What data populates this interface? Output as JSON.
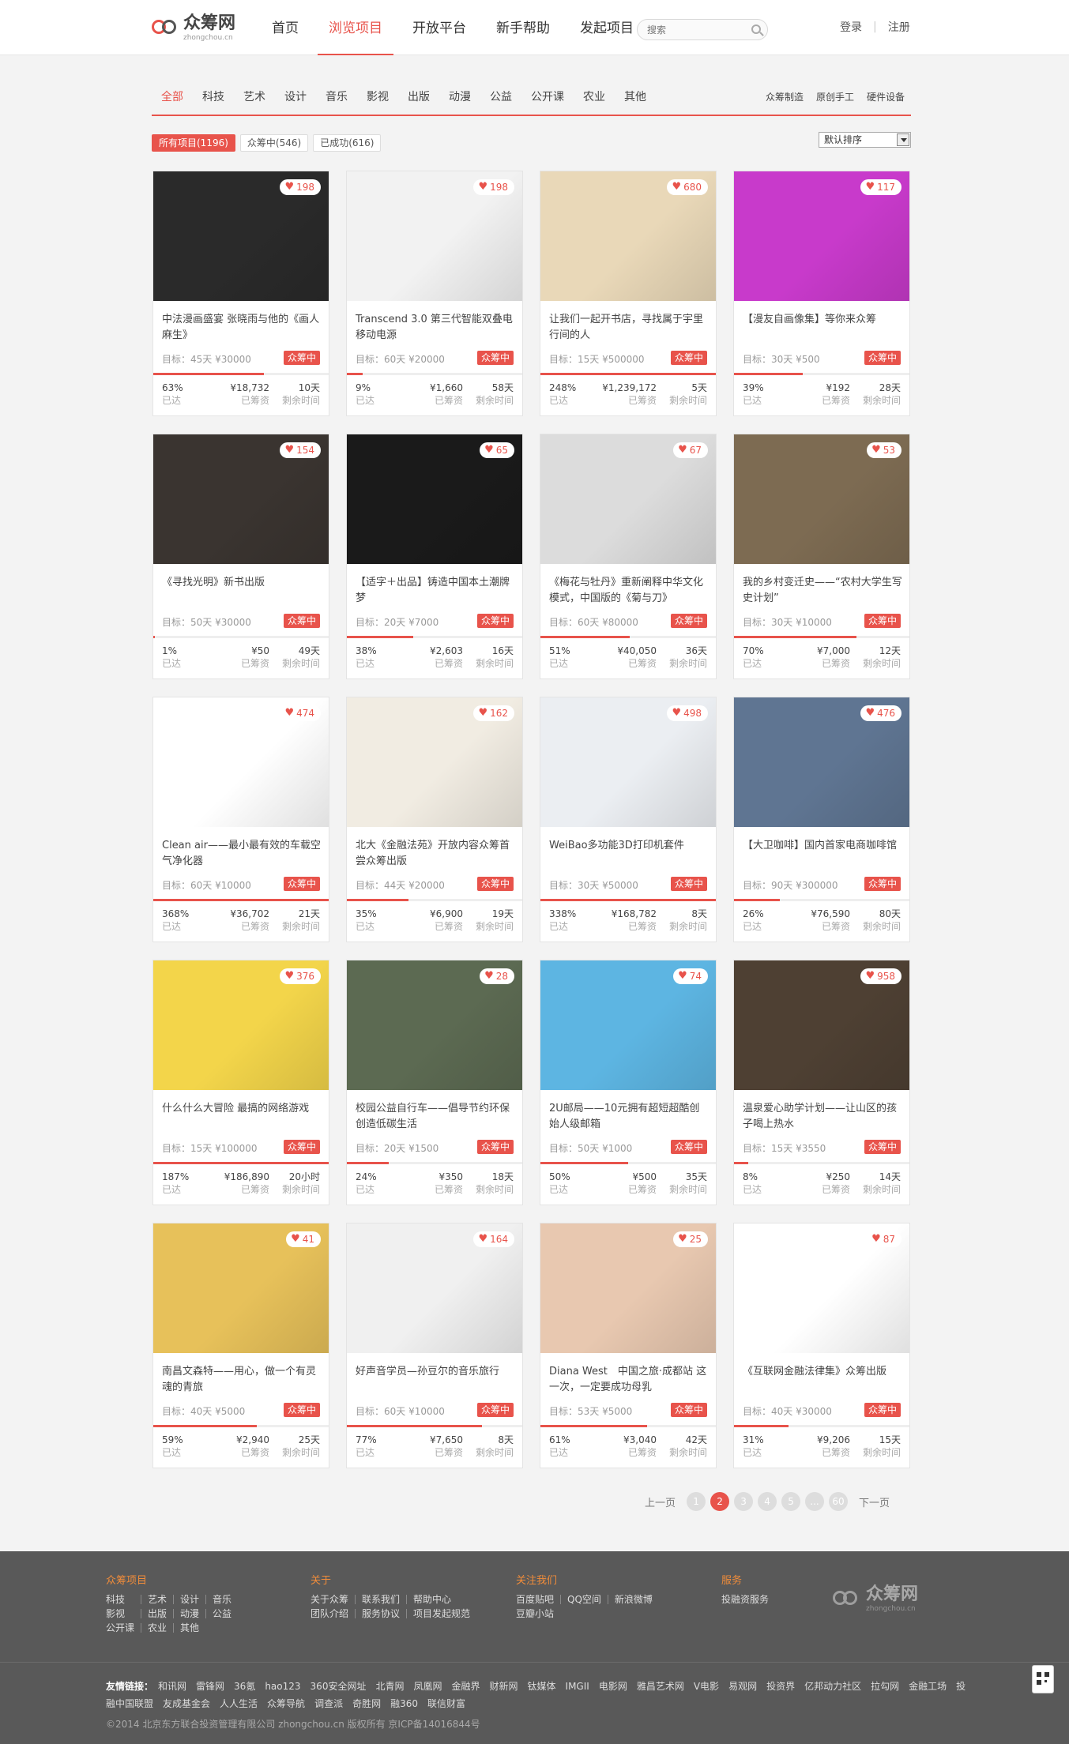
{
  "header": {
    "logo_cn": "众筹网",
    "logo_en": "zhongchou.cn",
    "nav": [
      "首页",
      "浏览项目",
      "开放平台",
      "新手帮助",
      "发起项目"
    ],
    "nav_active": 1,
    "search_placeholder": "搜索",
    "login": "登录",
    "register": "注册"
  },
  "categories": {
    "items": [
      "全部",
      "科技",
      "艺术",
      "设计",
      "音乐",
      "影视",
      "出版",
      "动漫",
      "公益",
      "公开课",
      "农业",
      "其他"
    ],
    "active": 0,
    "right": [
      "众筹制造",
      "原创手工",
      "硬件设备"
    ]
  },
  "filters": {
    "tabs": [
      "所有项目(1196)",
      "众筹中(546)",
      "已成功(616)"
    ],
    "active": 0,
    "sort_value": "默认排序"
  },
  "labels": {
    "goal_prefix": "目标：",
    "status": "众筹中",
    "reached": "已达",
    "raised": "已筹资",
    "remaining": "剩余时间"
  },
  "projects": [
    {
      "title": "中法漫画盛宴 张晓雨与他的《画人麻生》",
      "goal": "45天 ¥30000",
      "likes": "198",
      "pct": "63%",
      "amount": "¥18,732",
      "days": "10天",
      "progress": 0.63,
      "color": "#2a2a2a"
    },
    {
      "title": "Transcend 3.0 第三代智能双叠电移动电源",
      "goal": "60天 ¥20000",
      "likes": "198",
      "pct": "9%",
      "amount": "¥1,660",
      "days": "58天",
      "progress": 0.09,
      "color": "#f2f2f2"
    },
    {
      "title": "让我们一起开书店，寻找属于宇里行间的人",
      "goal": "15天 ¥500000",
      "likes": "680",
      "pct": "248%",
      "amount": "¥1,239,172",
      "days": "5天",
      "progress": 1.0,
      "color": "#e9d8b8"
    },
    {
      "title": "【漫友自画像集】等你来众筹",
      "goal": "30天 ¥500",
      "likes": "117",
      "pct": "39%",
      "amount": "¥192",
      "days": "28天",
      "progress": 0.39,
      "color": "#c83acb"
    },
    {
      "title": "《寻找光明》新书出版",
      "goal": "50天 ¥30000",
      "likes": "154",
      "pct": "1%",
      "amount": "¥50",
      "days": "49天",
      "progress": 0.01,
      "color": "#3a3430"
    },
    {
      "title": "【适字＋出品】铸造中国本土潮牌梦",
      "goal": "20天 ¥7000",
      "likes": "65",
      "pct": "38%",
      "amount": "¥2,603",
      "days": "16天",
      "progress": 0.38,
      "color": "#1a1a1a"
    },
    {
      "title": "《梅花与牡丹》重新阐释中华文化模式，中国版的《菊与刀》",
      "goal": "60天 ¥80000",
      "likes": "67",
      "pct": "51%",
      "amount": "¥40,050",
      "days": "36天",
      "progress": 0.51,
      "color": "#dcdcdc"
    },
    {
      "title": "我的乡村变迁史——“农村大学生写史计划”",
      "goal": "30天 ¥10000",
      "likes": "53",
      "pct": "70%",
      "amount": "¥7,000",
      "days": "12天",
      "progress": 0.7,
      "color": "#7d6b52"
    },
    {
      "title": "Clean air——最小最有效的车载空气净化器",
      "goal": "60天 ¥10000",
      "likes": "474",
      "pct": "368%",
      "amount": "¥36,702",
      "days": "21天",
      "progress": 1.0,
      "color": "#ffffff"
    },
    {
      "title": "北大《金融法苑》开放内容众筹首尝众筹出版",
      "goal": "44天 ¥20000",
      "likes": "162",
      "pct": "35%",
      "amount": "¥6,900",
      "days": "19天",
      "progress": 0.35,
      "color": "#f1ece2"
    },
    {
      "title": "WeiBao多功能3D打印机套件",
      "goal": "30天 ¥50000",
      "likes": "498",
      "pct": "338%",
      "amount": "¥168,782",
      "days": "8天",
      "progress": 1.0,
      "color": "#ebeef2"
    },
    {
      "title": "【大卫咖啡】国内首家电商咖啡馆",
      "goal": "90天 ¥300000",
      "likes": "476",
      "pct": "26%",
      "amount": "¥76,590",
      "days": "80天",
      "progress": 0.26,
      "color": "#5f7592"
    },
    {
      "title": "什么什么大冒险 最搞的网络游戏",
      "goal": "15天 ¥100000",
      "likes": "376",
      "pct": "187%",
      "amount": "¥186,890",
      "days": "20小时",
      "progress": 1.0,
      "color": "#f3d54a"
    },
    {
      "title": "校园公益自行车——倡导节约环保 创造低碳生活",
      "goal": "20天 ¥1500",
      "likes": "28",
      "pct": "24%",
      "amount": "¥350",
      "days": "18天",
      "progress": 0.24,
      "color": "#5c6a52"
    },
    {
      "title": "2U邮局——10元拥有超短超酷创始人级邮箱",
      "goal": "50天 ¥1000",
      "likes": "74",
      "pct": "50%",
      "amount": "¥500",
      "days": "35天",
      "progress": 0.5,
      "color": "#5db5e2"
    },
    {
      "title": "温泉爱心助学计划——让山区的孩子喝上热水",
      "goal": "15天 ¥3550",
      "likes": "958",
      "pct": "8%",
      "amount": "¥250",
      "days": "14天",
      "progress": 0.08,
      "color": "#4e4033"
    },
    {
      "title": "南昌文森特——用心，做一个有灵魂的青旅",
      "goal": "40天 ¥5000",
      "likes": "41",
      "pct": "59%",
      "amount": "¥2,940",
      "days": "25天",
      "progress": 0.59,
      "color": "#e7c15a"
    },
    {
      "title": "好声音学员—孙豆尔的音乐旅行",
      "goal": "60天 ¥10000",
      "likes": "164",
      "pct": "77%",
      "amount": "¥7,650",
      "days": "8天",
      "progress": 0.77,
      "color": "#f0f0f0"
    },
    {
      "title": "Diana West　中国之旅·成都站 这一次，一定要成功母乳",
      "goal": "53天 ¥5000",
      "likes": "25",
      "pct": "61%",
      "amount": "¥3,040",
      "days": "42天",
      "progress": 0.61,
      "color": "#e8c8b0"
    },
    {
      "title": "《互联网金融法律集》众筹出版",
      "goal": "40天 ¥30000",
      "likes": "87",
      "pct": "31%",
      "amount": "¥9,206",
      "days": "15天",
      "progress": 0.31,
      "color": "#ffffff"
    }
  ],
  "pagination": {
    "prev": "上一页",
    "next": "下一页",
    "pages": [
      "1",
      "2",
      "3",
      "4",
      "5",
      "...",
      "60"
    ],
    "active": 1
  },
  "footer": {
    "cols": [
      {
        "heading": "众筹项目",
        "links": [
          "科技",
          "艺术",
          "设计",
          "音乐",
          "影视",
          "出版",
          "动漫",
          "公益",
          "公开课",
          "农业",
          "其他"
        ]
      },
      {
        "heading": "关于",
        "links": [
          "关于众筹",
          "联系我们",
          "帮助中心",
          "团队介绍",
          "服务协议",
          "项目发起规范"
        ]
      },
      {
        "heading": "关注我们",
        "links": [
          "百度贴吧",
          "QQ空间",
          "新浪微博",
          "豆瓣小站"
        ]
      },
      {
        "heading": "服务",
        "links": [
          "投融资服务"
        ]
      }
    ],
    "logo_cn": "众筹网",
    "logo_en": "zhongchou.cn",
    "friends_label": "友情链接：",
    "friends": [
      "和讯网",
      "雷锋网",
      "36氪",
      "hao123",
      "360安全网址",
      "北青网",
      "凤凰网",
      "金融界",
      "财新网",
      "钛媒体",
      "IMGII",
      "电影网",
      "雅昌艺术网",
      "V电影",
      "易观网",
      "投资界",
      "亿邦动力社区",
      "拉勾网",
      "金融工场",
      "投融中国联盟",
      "友成基金会",
      "人人生活",
      "众筹导航",
      "调查派",
      "奇胜网",
      "融360",
      "联信财富"
    ],
    "copyright": "©2014 北京东方联合投资管理有限公司 zhongchou.cn 版权所有 京ICP备14016844号"
  }
}
